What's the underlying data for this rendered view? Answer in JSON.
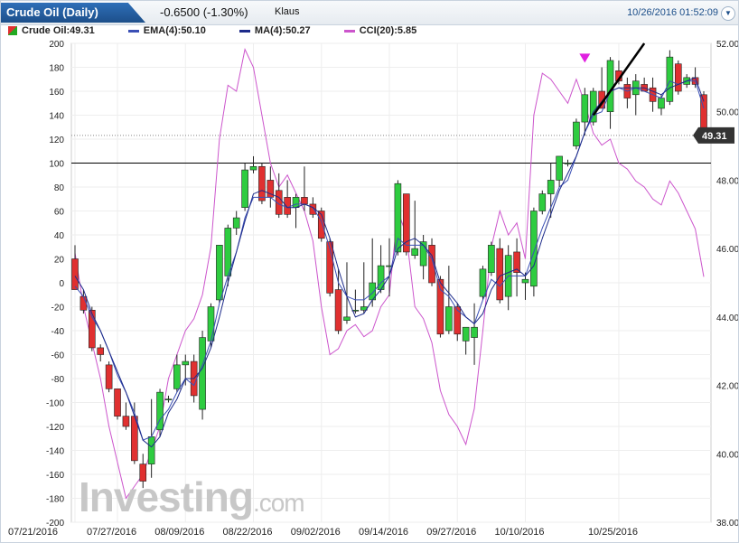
{
  "header": {
    "tab_label": "Crude Oil (Daily)",
    "change": "-0.6500 (-1.30%)",
    "author": "Klaus",
    "timestamp": "10/26/2016 01:52:09",
    "dropdown_icon": "chevron-down-icon"
  },
  "legend": [
    {
      "label": "Crude Oil:49.31",
      "swatch": "candle"
    },
    {
      "label": "EMA(4):50.10",
      "color": "#3a4fb5"
    },
    {
      "label": "MA(4):50.27",
      "color": "#1d2b8a"
    },
    {
      "label": "CCI(20):5.85",
      "color": "#cc55cc"
    }
  ],
  "watermark": {
    "brand": "Investing",
    "suffix": ".com"
  },
  "colors": {
    "up": "#2ecc40",
    "down": "#e03030",
    "ema": "#3a4fb5",
    "ma": "#1d2b8a",
    "cci": "#cc55cc",
    "marker": "#e020e0",
    "price_tag": "#333333"
  },
  "chart_data": {
    "type": "candlestick",
    "x_ticks": [
      "07/21/2016",
      "07/27/2016",
      "08/09/2016",
      "08/22/2016",
      "09/02/2016",
      "09/14/2016",
      "09/27/2016",
      "10/10/2016",
      "10/25/2016"
    ],
    "x_tick_index": [
      0,
      5,
      13,
      21,
      29,
      37,
      45,
      53,
      64
    ],
    "y_right_ticks": [
      "52.00",
      "50.00",
      "48.00",
      "46.00",
      "44.00",
      "42.00",
      "40.00",
      "38.00"
    ],
    "y_right_range": [
      38,
      52
    ],
    "y_left_ticks": [
      200,
      180,
      160,
      140,
      120,
      100,
      80,
      60,
      40,
      20,
      0,
      -20,
      -40,
      -60,
      -80,
      -100,
      -120,
      -140,
      -160,
      -180,
      -200
    ],
    "y_left_range": [
      -200,
      200
    ],
    "last_price": "49.31",
    "cci_reference_lines": [
      100,
      125
    ],
    "candles": [
      {
        "o": 45.7,
        "h": 46.1,
        "l": 44.9,
        "c": 44.8
      },
      {
        "o": 44.6,
        "h": 44.8,
        "l": 44.1,
        "c": 44.2
      },
      {
        "o": 44.2,
        "h": 44.3,
        "l": 43.0,
        "c": 43.1
      },
      {
        "o": 43.1,
        "h": 43.2,
        "l": 42.7,
        "c": 42.9
      },
      {
        "o": 42.6,
        "h": 42.7,
        "l": 41.8,
        "c": 41.9
      },
      {
        "o": 41.9,
        "h": 41.9,
        "l": 41.0,
        "c": 41.1
      },
      {
        "o": 41.1,
        "h": 41.5,
        "l": 40.7,
        "c": 40.8
      },
      {
        "o": 41.1,
        "h": 41.5,
        "l": 39.7,
        "c": 39.8
      },
      {
        "o": 39.7,
        "h": 40.0,
        "l": 39.0,
        "c": 39.2
      },
      {
        "o": 39.7,
        "h": 41.6,
        "l": 39.3,
        "c": 40.5
      },
      {
        "o": 40.7,
        "h": 41.9,
        "l": 40.5,
        "c": 41.8
      },
      {
        "o": 41.6,
        "h": 41.7,
        "l": 41.5,
        "c": 41.6
      },
      {
        "o": 41.9,
        "h": 42.9,
        "l": 41.8,
        "c": 42.6
      },
      {
        "o": 42.6,
        "h": 42.9,
        "l": 42.0,
        "c": 42.7
      },
      {
        "o": 42.7,
        "h": 42.9,
        "l": 41.5,
        "c": 41.7
      },
      {
        "o": 41.3,
        "h": 43.6,
        "l": 41.0,
        "c": 43.4
      },
      {
        "o": 43.3,
        "h": 44.4,
        "l": 43.1,
        "c": 44.3
      },
      {
        "o": 44.5,
        "h": 46.1,
        "l": 44.4,
        "c": 46.1
      },
      {
        "o": 45.2,
        "h": 46.7,
        "l": 44.9,
        "c": 46.6
      },
      {
        "o": 46.6,
        "h": 47.1,
        "l": 46.4,
        "c": 46.9
      },
      {
        "o": 47.2,
        "h": 48.5,
        "l": 47.1,
        "c": 48.3
      },
      {
        "o": 48.3,
        "h": 48.7,
        "l": 48.2,
        "c": 48.4
      },
      {
        "o": 48.4,
        "h": 48.5,
        "l": 47.3,
        "c": 47.4
      },
      {
        "o": 48.0,
        "h": 48.4,
        "l": 47.2,
        "c": 47.5
      },
      {
        "o": 47.7,
        "h": 48.2,
        "l": 46.9,
        "c": 47.0
      },
      {
        "o": 47.5,
        "h": 48.0,
        "l": 46.9,
        "c": 47.0
      },
      {
        "o": 47.2,
        "h": 47.6,
        "l": 46.6,
        "c": 47.5
      },
      {
        "o": 47.5,
        "h": 48.4,
        "l": 47.1,
        "c": 47.3
      },
      {
        "o": 47.3,
        "h": 47.5,
        "l": 46.9,
        "c": 47.0
      },
      {
        "o": 47.1,
        "h": 47.2,
        "l": 46.2,
        "c": 46.3
      },
      {
        "o": 46.2,
        "h": 46.3,
        "l": 44.6,
        "c": 44.7
      },
      {
        "o": 44.8,
        "h": 45.4,
        "l": 43.5,
        "c": 43.6
      },
      {
        "o": 43.9,
        "h": 45.6,
        "l": 43.8,
        "c": 44.0
      },
      {
        "o": 44.2,
        "h": 44.8,
        "l": 44.1,
        "c": 44.2
      },
      {
        "o": 44.2,
        "h": 45.6,
        "l": 44.1,
        "c": 44.3
      },
      {
        "o": 44.5,
        "h": 46.3,
        "l": 44.3,
        "c": 45.0
      },
      {
        "o": 44.8,
        "h": 46.1,
        "l": 44.7,
        "c": 45.5
      },
      {
        "o": 45.5,
        "h": 46.3,
        "l": 44.6,
        "c": 45.5
      },
      {
        "o": 45.9,
        "h": 48.0,
        "l": 45.8,
        "c": 47.9
      },
      {
        "o": 47.6,
        "h": 47.6,
        "l": 45.8,
        "c": 45.9
      },
      {
        "o": 45.8,
        "h": 47.4,
        "l": 45.7,
        "c": 46.0
      },
      {
        "o": 45.5,
        "h": 46.4,
        "l": 45.1,
        "c": 46.2
      },
      {
        "o": 46.1,
        "h": 46.3,
        "l": 44.9,
        "c": 45.0
      },
      {
        "o": 45.1,
        "h": 45.2,
        "l": 43.4,
        "c": 43.5
      },
      {
        "o": 43.6,
        "h": 45.5,
        "l": 43.5,
        "c": 44.3
      },
      {
        "o": 44.3,
        "h": 44.4,
        "l": 43.3,
        "c": 43.5
      },
      {
        "o": 43.3,
        "h": 43.7,
        "l": 42.9,
        "c": 43.7
      },
      {
        "o": 43.4,
        "h": 44.4,
        "l": 42.6,
        "c": 43.7
      },
      {
        "o": 44.6,
        "h": 45.5,
        "l": 44.5,
        "c": 45.4
      },
      {
        "o": 45.3,
        "h": 46.2,
        "l": 45.2,
        "c": 46.1
      },
      {
        "o": 46.0,
        "h": 46.3,
        "l": 44.4,
        "c": 44.5
      },
      {
        "o": 44.6,
        "h": 46.1,
        "l": 44.2,
        "c": 45.8
      },
      {
        "o": 45.9,
        "h": 46.3,
        "l": 44.6,
        "c": 45.3
      },
      {
        "o": 45.0,
        "h": 45.3,
        "l": 44.5,
        "c": 45.1
      },
      {
        "o": 44.9,
        "h": 47.2,
        "l": 44.6,
        "c": 47.1
      },
      {
        "o": 47.1,
        "h": 47.7,
        "l": 47.0,
        "c": 47.6
      },
      {
        "o": 47.6,
        "h": 48.5,
        "l": 46.9,
        "c": 48.0
      },
      {
        "o": 48.0,
        "h": 48.7,
        "l": 47.8,
        "c": 48.7
      },
      {
        "o": 48.5,
        "h": 48.6,
        "l": 48.4,
        "c": 48.5
      },
      {
        "o": 49.0,
        "h": 49.8,
        "l": 48.9,
        "c": 49.7
      },
      {
        "o": 49.7,
        "h": 50.7,
        "l": 49.3,
        "c": 50.5
      },
      {
        "o": 49.7,
        "h": 50.7,
        "l": 49.6,
        "c": 50.6
      },
      {
        "o": 50.6,
        "h": 51.3,
        "l": 50.2,
        "c": 50.1
      },
      {
        "o": 50.0,
        "h": 51.6,
        "l": 49.5,
        "c": 51.5
      },
      {
        "o": 51.2,
        "h": 51.5,
        "l": 50.8,
        "c": 50.9
      },
      {
        "o": 50.8,
        "h": 51.0,
        "l": 50.1,
        "c": 50.4
      },
      {
        "o": 50.5,
        "h": 51.1,
        "l": 49.9,
        "c": 50.9
      },
      {
        "o": 50.8,
        "h": 51.0,
        "l": 50.7,
        "c": 50.6
      }
    ],
    "candles_tail": [
      {
        "o": 50.7,
        "h": 51.0,
        "l": 50.0,
        "c": 50.3
      },
      {
        "o": 50.1,
        "h": 50.5,
        "l": 49.9,
        "c": 50.4
      },
      {
        "o": 50.3,
        "h": 51.8,
        "l": 50.2,
        "c": 51.6
      },
      {
        "o": 51.4,
        "h": 51.5,
        "l": 50.5,
        "c": 50.6
      },
      {
        "o": 50.8,
        "h": 51.1,
        "l": 50.7,
        "c": 51.0
      },
      {
        "o": 51.0,
        "h": 51.3,
        "l": 50.7,
        "c": 50.8
      },
      {
        "o": 50.5,
        "h": 50.6,
        "l": 49.3,
        "c": 49.3
      }
    ],
    "ema": [
      44.9,
      44.6,
      44.0,
      43.6,
      43.0,
      42.3,
      41.8,
      41.2,
      40.4,
      40.5,
      41.0,
      41.3,
      41.8,
      42.2,
      42.0,
      42.6,
      43.3,
      44.4,
      45.2,
      45.9,
      46.9,
      47.5,
      47.5,
      47.5,
      47.3,
      47.2,
      47.3,
      47.3,
      47.2,
      46.8,
      46.0,
      45.0,
      44.6,
      44.5,
      44.5,
      44.7,
      45.0,
      45.2,
      46.3,
      46.1,
      46.1,
      46.1,
      45.7,
      44.8,
      44.6,
      44.2,
      44.0,
      43.8,
      44.5,
      45.1,
      44.9,
      45.2,
      45.2,
      45.2,
      45.9,
      46.6,
      47.2,
      47.8,
      48.0,
      48.7,
      49.4,
      49.9,
      50.0,
      50.6,
      50.7,
      50.6,
      50.7,
      50.6,
      50.5,
      50.4,
      50.9,
      50.8,
      50.9,
      50.9,
      50.1
    ],
    "ma": [
      45.2,
      44.8,
      44.1,
      43.6,
      43.0,
      42.4,
      41.8,
      41.1,
      40.4,
      40.2,
      40.5,
      41.2,
      41.6,
      42.2,
      42.2,
      42.5,
      43.1,
      44.0,
      45.0,
      45.9,
      46.8,
      47.6,
      47.7,
      47.6,
      47.5,
      47.2,
      47.2,
      47.3,
      47.2,
      47.0,
      46.3,
      45.4,
      44.6,
      44.0,
      44.1,
      44.5,
      44.8,
      45.2,
      46.0,
      46.2,
      46.3,
      46.1,
      45.8,
      45.0,
      44.7,
      44.4,
      44.0,
      43.8,
      44.1,
      44.8,
      45.2,
      45.3,
      45.4,
      45.2,
      45.5,
      46.3,
      47.0,
      47.7,
      48.2,
      48.7,
      49.4,
      50.0,
      50.3,
      50.6,
      50.7,
      50.7,
      50.7,
      50.7,
      50.6,
      50.5,
      50.7,
      50.8,
      50.9,
      51.0,
      50.3
    ],
    "cci": [
      25,
      -20,
      -50,
      -80,
      -120,
      -150,
      -180,
      -170,
      -160,
      -140,
      -120,
      -80,
      -60,
      -40,
      -30,
      -10,
      30,
      120,
      165,
      160,
      195,
      180,
      140,
      100,
      80,
      90,
      75,
      60,
      35,
      -20,
      -60,
      -55,
      -40,
      -35,
      -45,
      -40,
      -20,
      -10,
      60,
      40,
      -20,
      -30,
      -50,
      -90,
      -110,
      -120,
      -135,
      -105,
      -40,
      30,
      60,
      40,
      50,
      20,
      140,
      175,
      170,
      160,
      150,
      170,
      150,
      125,
      115,
      120,
      100,
      95,
      85,
      80,
      70,
      65,
      85,
      75,
      60,
      45,
      5
    ]
  }
}
